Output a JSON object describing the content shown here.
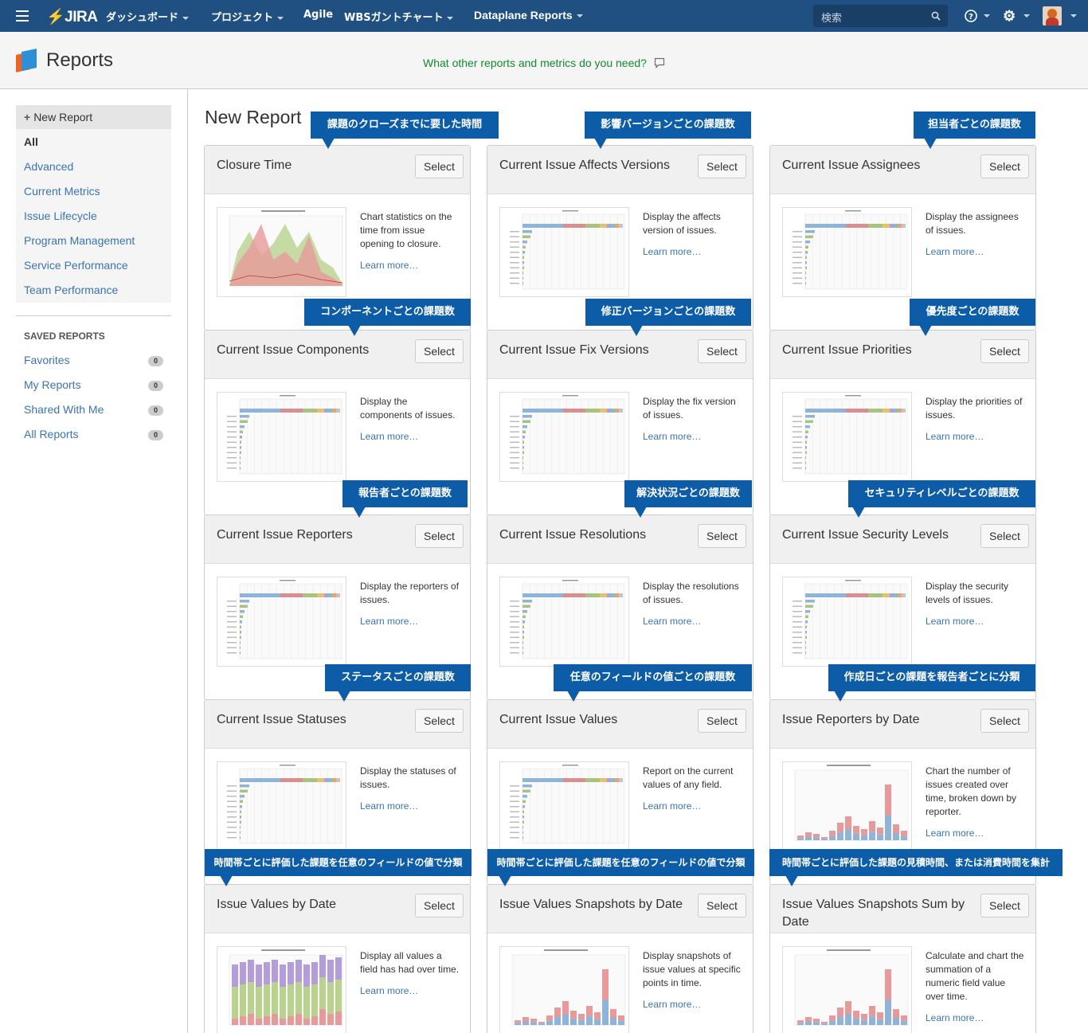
{
  "topnav": {
    "logo": "JIRA",
    "items": [
      {
        "label": "ダッシュボード",
        "dropdown": true
      },
      {
        "label": "プロジェクト",
        "dropdown": true
      },
      {
        "label": "Agile",
        "dropdown": false
      },
      {
        "label": "WBSガントチャート",
        "dropdown": true
      },
      {
        "label": "Dataplane Reports",
        "dropdown": true
      }
    ],
    "search_placeholder": "検索"
  },
  "header": {
    "title": "Reports",
    "feedback": "What other reports and metrics do you need?"
  },
  "sidebar": {
    "new_report": "New Report",
    "categories": [
      "All",
      "Advanced",
      "Current Metrics",
      "Issue Lifecycle",
      "Program Management",
      "Service Performance",
      "Team Performance"
    ],
    "saved_heading": "SAVED REPORTS",
    "saved": [
      {
        "label": "Favorites",
        "count": "0"
      },
      {
        "label": "My Reports",
        "count": "0"
      },
      {
        "label": "Shared With Me",
        "count": "0"
      },
      {
        "label": "All Reports",
        "count": "0"
      }
    ]
  },
  "main": {
    "title": "New Report",
    "select_label": "Select",
    "learn_more": "Learn more…",
    "cards": [
      {
        "title": "Closure Time",
        "desc": "Chart statistics on the time from issue opening to closure.",
        "callout": "課題のクローズまでに要した時間",
        "thumb": "area"
      },
      {
        "title": "Current Issue Affects Versions",
        "desc": "Display the affects version of issues.",
        "callout": "影響バージョンごとの課題数",
        "thumb": "hbar"
      },
      {
        "title": "Current Issue Assignees",
        "desc": "Display the assignees of issues.",
        "callout": "担当者ごとの課題数",
        "thumb": "hbar"
      },
      {
        "title": "Current Issue Components",
        "desc": "Display the components of issues.",
        "callout": "コンポーネントごとの課題数",
        "thumb": "hbar"
      },
      {
        "title": "Current Issue Fix Versions",
        "desc": "Display the fix version of issues.",
        "callout": "修正バージョンごとの課題数",
        "thumb": "hbar"
      },
      {
        "title": "Current Issue Priorities",
        "desc": "Display the priorities of issues.",
        "callout": "優先度ごとの課題数",
        "thumb": "hbar"
      },
      {
        "title": "Current Issue Reporters",
        "desc": "Display the reporters of issues.",
        "callout": "報告者ごとの課題数",
        "thumb": "hbar"
      },
      {
        "title": "Current Issue Resolutions",
        "desc": "Display the resolutions of issues.",
        "callout": "解決状況ごとの課題数",
        "thumb": "hbar"
      },
      {
        "title": "Current Issue Security Levels",
        "desc": "Display the security levels of issues.",
        "callout": "セキュリティレベルごとの課題数",
        "thumb": "hbar"
      },
      {
        "title": "Current Issue Statuses",
        "desc": "Display the statuses of issues.",
        "callout": "ステータスごとの課題数",
        "thumb": "hbar"
      },
      {
        "title": "Current Issue Values",
        "desc": "Report on the current values of any field.",
        "callout": "任意のフィールドの値ごとの課題数",
        "thumb": "hbar"
      },
      {
        "title": "Issue Reporters by Date",
        "desc": "Chart the number of issues created over time, broken down by reporter.",
        "callout": "作成日ごとの課題を報告者ごとに分類",
        "thumb": "vbar"
      },
      {
        "title": "Issue Values by Date",
        "desc": "Display all values a field has had over time.",
        "callout": "時間帯ごとに評価した課題を任意のフィールドの値で分類",
        "thumb": "stack"
      },
      {
        "title": "Issue Values Snapshots by Date",
        "desc": "Display snapshots of issue values at specific points in time.",
        "callout": "時間帯ごとに評価した課題を任意のフィールドの値で分類",
        "thumb": "vbar"
      },
      {
        "title": "Issue Values Snapshots Sum by Date",
        "desc": "Calculate and chart the summation of a numeric field value over time.",
        "callout": "時間帯ごとに評価した課題の見積時間、または消費時間を集計",
        "thumb": "vbar"
      }
    ]
  },
  "colors": {
    "nav": "#205081",
    "callout": "#0d5ca8",
    "link": "#3b73af",
    "feedback": "#14892c"
  }
}
